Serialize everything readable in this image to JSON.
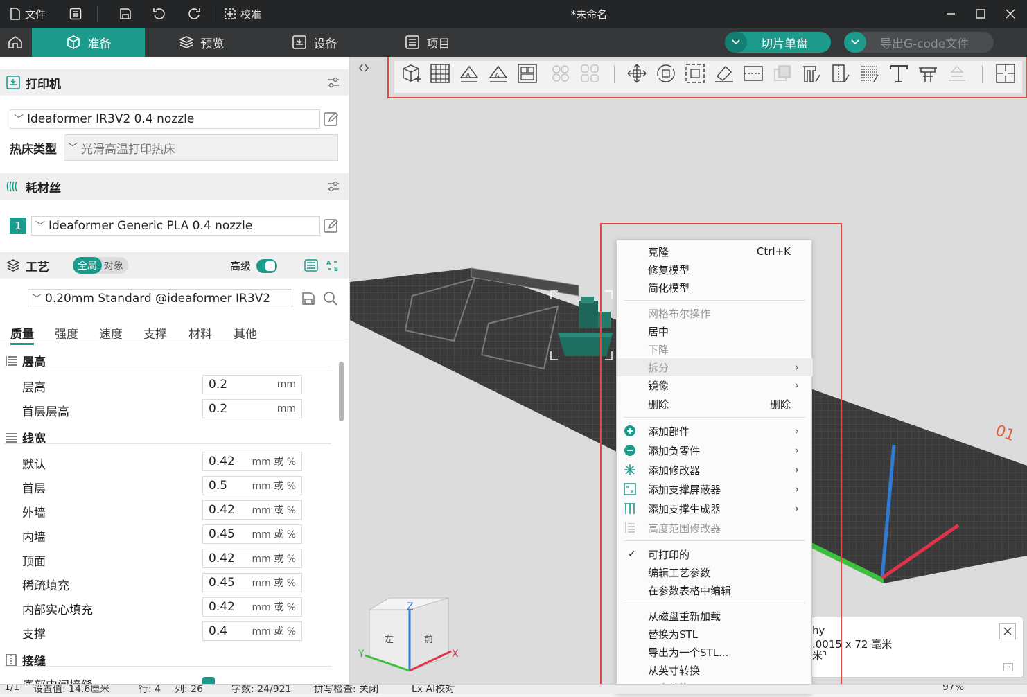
{
  "window": {
    "title": "*未命名",
    "file_label": "文件",
    "calibrate_label": "校准"
  },
  "nav": {
    "tabs": [
      {
        "label": "准备"
      },
      {
        "label": "预览"
      },
      {
        "label": "设备"
      },
      {
        "label": "项目"
      }
    ],
    "slice_label": "切片单盘",
    "export_label": "导出G-code文件"
  },
  "printer": {
    "section_title": "打印机",
    "preset": "Ideaformer IR3V2 0.4 nozzle",
    "bed_type_label": "热床类型",
    "bed_type": "光滑高温打印热床"
  },
  "filament": {
    "section_title": "耗材丝",
    "slot": "1",
    "preset": "Ideaformer Generic PLA 0.4 nozzle"
  },
  "process": {
    "section_title": "工艺",
    "toggle_global": "全局",
    "toggle_object": "对象",
    "advanced_label": "高级",
    "preset": "0.20mm Standard @ideaformer IR3V2",
    "tabs": [
      "质量",
      "强度",
      "速度",
      "支撑",
      "材料",
      "其他"
    ]
  },
  "settings": {
    "layer_height_group": "层高",
    "layer_rows": [
      {
        "label": "层高",
        "value": "0.2",
        "unit": "mm"
      },
      {
        "label": "首层层高",
        "value": "0.2",
        "unit": "mm"
      }
    ],
    "line_width_group": "线宽",
    "width_rows": [
      {
        "label": "默认",
        "value": "0.42",
        "unit": "mm 或 %"
      },
      {
        "label": "首层",
        "value": "0.5",
        "unit": "mm 或 %"
      },
      {
        "label": "外墙",
        "value": "0.42",
        "unit": "mm 或 %"
      },
      {
        "label": "内墙",
        "value": "0.45",
        "unit": "mm 或 %"
      },
      {
        "label": "顶面",
        "value": "0.42",
        "unit": "mm 或 %"
      },
      {
        "label": "稀疏填充",
        "value": "0.45",
        "unit": "mm 或 %"
      },
      {
        "label": "内部实心填充",
        "value": "0.42",
        "unit": "mm 或 %"
      },
      {
        "label": "支撑",
        "value": "0.4",
        "unit": "mm 或 %"
      }
    ],
    "seam_group": "接缝",
    "seam_row": "底部中间接缝"
  },
  "context_menu": {
    "items": [
      {
        "label": "克隆",
        "shortcut": "Ctrl+K"
      },
      {
        "label": "修复模型"
      },
      {
        "label": "简化模型"
      },
      {
        "label": "网格布尔操作"
      },
      {
        "label": "居中"
      },
      {
        "label": "下降"
      },
      {
        "label": "拆分",
        "arrow": "›"
      },
      {
        "label": "镜像",
        "arrow": "›"
      },
      {
        "label": "删除",
        "shortcut": "删除"
      },
      {
        "label": "添加部件",
        "arrow": "›"
      },
      {
        "label": "添加负零件",
        "arrow": "›"
      },
      {
        "label": "添加修改器",
        "arrow": "›"
      },
      {
        "label": "添加支撑屏蔽器",
        "arrow": "›"
      },
      {
        "label": "添加支撑生成器",
        "arrow": "›"
      },
      {
        "label": "高度范围修改器"
      },
      {
        "label": "可打印的",
        "check": "✓"
      },
      {
        "label": "编辑工艺参数"
      },
      {
        "label": "在参数表格中编辑"
      },
      {
        "label": "从磁盘重新加载"
      },
      {
        "label": "替换为STL"
      },
      {
        "label": "导出为一个STL..."
      },
      {
        "label": "从英寸转换"
      },
      {
        "label": "从米转换"
      }
    ]
  },
  "info_panel": {
    "line1": "hy",
    "line2": ".0015 x 72 毫米",
    "line3": "米³"
  },
  "view_cube": {
    "z": "Z",
    "left": "左",
    "front": "前",
    "axis_x": "X",
    "axis_y": "Y"
  },
  "bed_label": "01",
  "status": {
    "page": "1/1",
    "size": "设置值: 14.6厘米",
    "row": "行: 4",
    "col": "列: 26",
    "chars": "字数: 24/921",
    "spell": "拼写检查: 关闭",
    "ai": "Lx AI校对",
    "zoom": "97%"
  },
  "colors": {
    "accent": "#1c9a8b",
    "model": "#1e6e60",
    "highlight_box": "#e0473e",
    "axis_x": "#e0334a",
    "axis_y": "#3cc13c",
    "axis_z": "#2f7bd6"
  }
}
